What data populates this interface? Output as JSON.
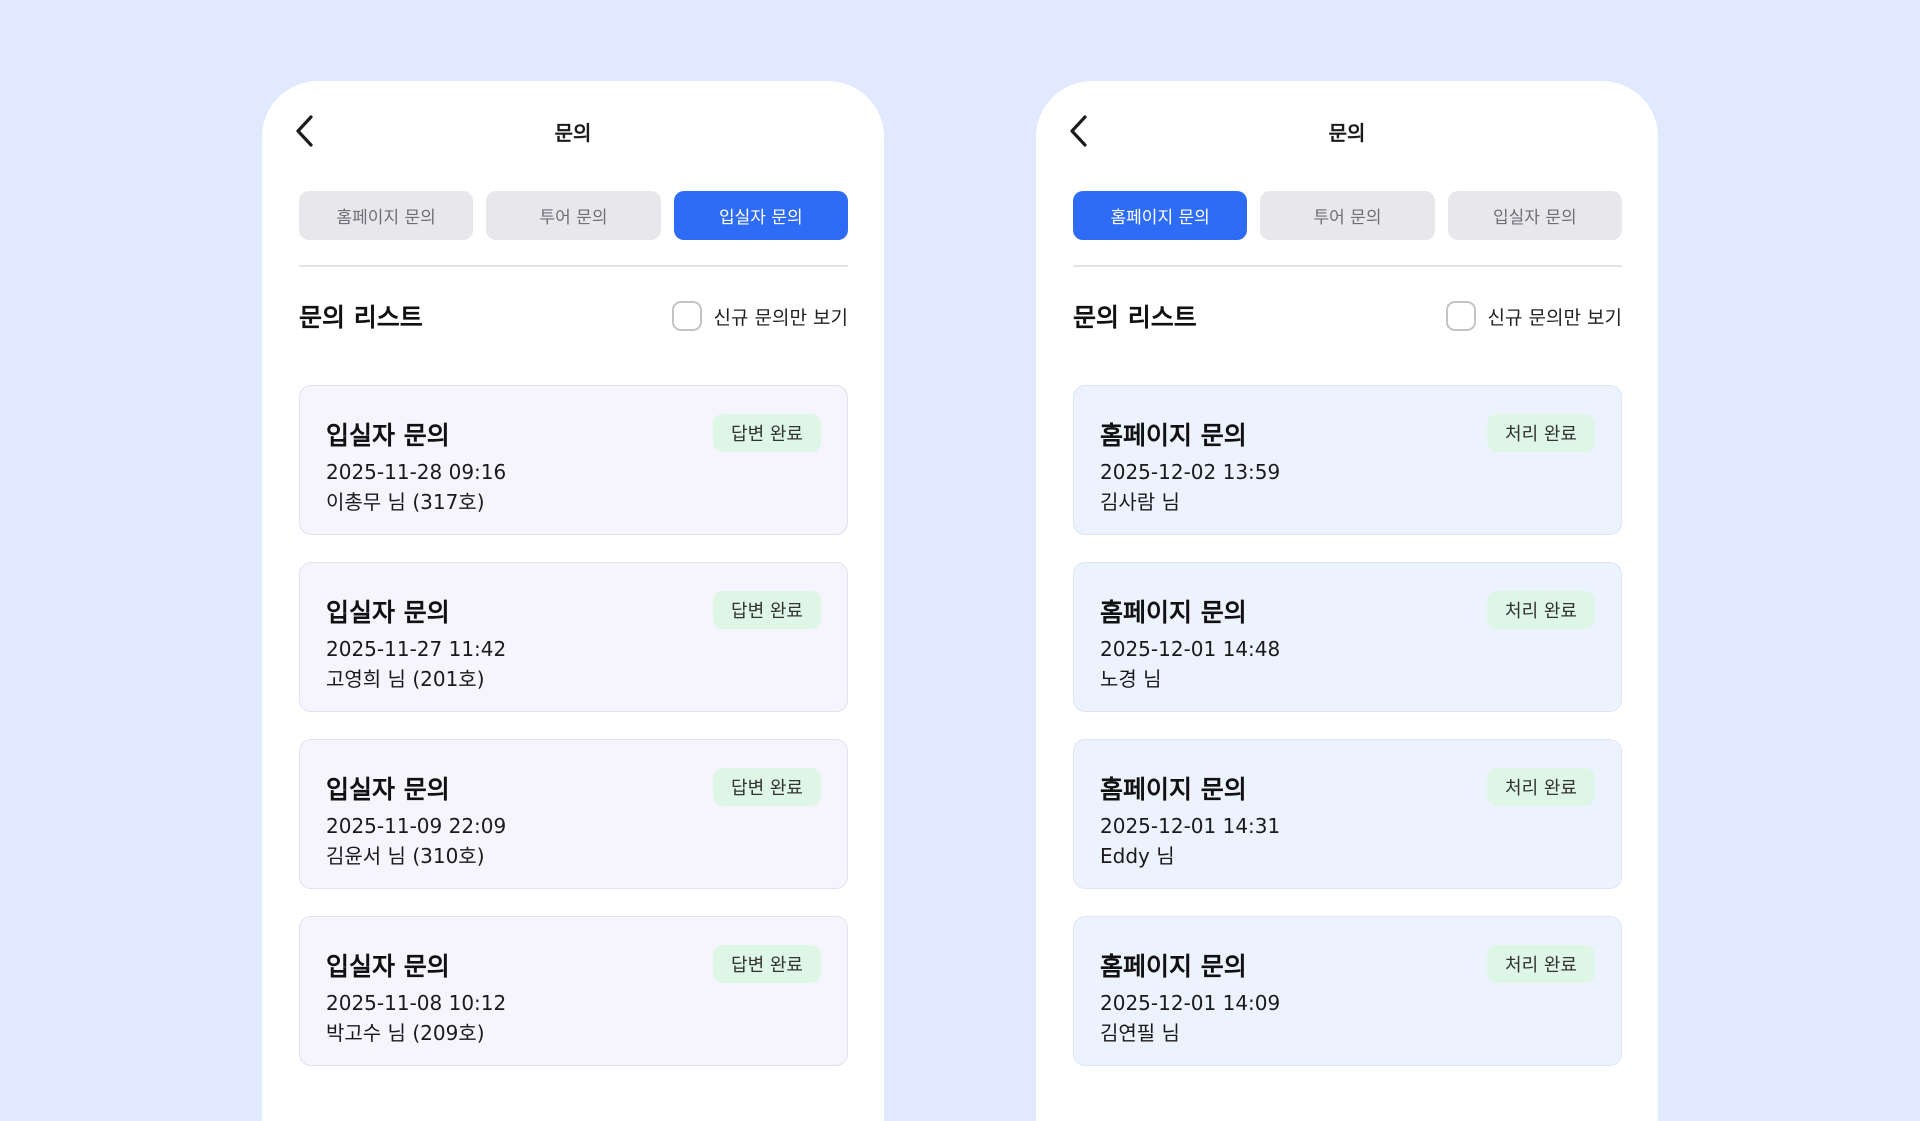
{
  "colors": {
    "background": "#e0e9fd",
    "accent": "#2f6cf5",
    "badge_bg": "#def6e6"
  },
  "left": {
    "title": "문의",
    "tabs": [
      {
        "label": "홈페이지 문의",
        "active": false
      },
      {
        "label": "투어 문의",
        "active": false
      },
      {
        "label": "입실자 문의",
        "active": true
      }
    ],
    "list_title": "문의 리스트",
    "filter_label": "신규 문의만 보기",
    "cards": [
      {
        "title": "입실자 문의",
        "status": "답변 완료",
        "date": "2025-11-28 09:16",
        "user": "이총무 님 (317호)"
      },
      {
        "title": "입실자 문의",
        "status": "답변 완료",
        "date": "2025-11-27 11:42",
        "user": "고영희 님 (201호)"
      },
      {
        "title": "입실자 문의",
        "status": "답변 완료",
        "date": "2025-11-09 22:09",
        "user": "김윤서 님 (310호)"
      },
      {
        "title": "입실자 문의",
        "status": "답변 완료",
        "date": "2025-11-08 10:12",
        "user": "박고수 님 (209호)"
      }
    ]
  },
  "right": {
    "title": "문의",
    "tabs": [
      {
        "label": "홈페이지 문의",
        "active": true
      },
      {
        "label": "투어 문의",
        "active": false
      },
      {
        "label": "입실자 문의",
        "active": false
      }
    ],
    "list_title": "문의 리스트",
    "filter_label": "신규 문의만 보기",
    "cards": [
      {
        "title": "홈페이지 문의",
        "status": "처리 완료",
        "date": "2025-12-02 13:59",
        "user": "김사람 님"
      },
      {
        "title": "홈페이지 문의",
        "status": "처리 완료",
        "date": "2025-12-01 14:48",
        "user": "노경 님"
      },
      {
        "title": "홈페이지 문의",
        "status": "처리 완료",
        "date": "2025-12-01 14:31",
        "user": "Eddy 님"
      },
      {
        "title": "홈페이지 문의",
        "status": "처리 완료",
        "date": "2025-12-01 14:09",
        "user": "김연필 님"
      }
    ]
  }
}
